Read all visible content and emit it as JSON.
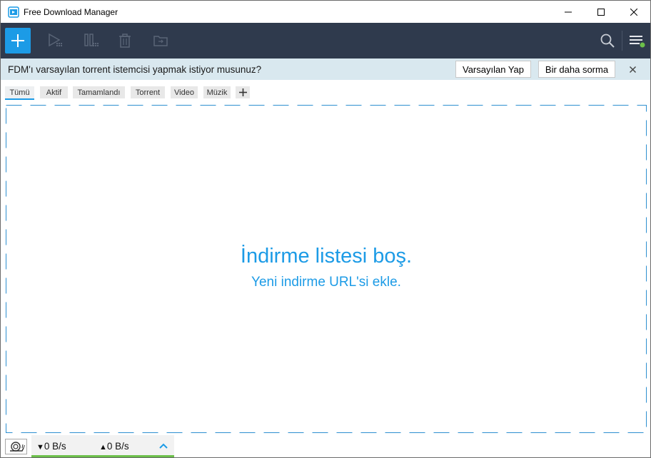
{
  "window": {
    "title": "Free Download Manager"
  },
  "notification": {
    "message": "FDM'ı varsayılan torrent istemcisi yapmak istiyor musunuz?",
    "make_default_label": "Varsayılan Yap",
    "dont_ask_label": "Bir daha sorma"
  },
  "tabs": [
    {
      "label": "Tümü"
    },
    {
      "label": "Aktif"
    },
    {
      "label": "Tamamlandı"
    },
    {
      "label": "Torrent"
    },
    {
      "label": "Video"
    },
    {
      "label": "Müzik"
    }
  ],
  "empty_state": {
    "title": "İndirme listesi boş.",
    "subtitle": "Yeni indirme URL'si ekle."
  },
  "status": {
    "download_speed": "0 B/s",
    "upload_speed": "0 B/s",
    "download_arrow": "▼",
    "upload_arrow": "▲"
  },
  "colors": {
    "accent": "#1c9be6",
    "toolbar_bg": "#2f3a4d",
    "notify_bg": "#d9e8ef",
    "status_ok": "#6cc04a"
  },
  "icons": {
    "app": "fdm-logo-icon",
    "add": "plus-icon",
    "start": "play-icon",
    "pause": "pause-icon",
    "delete": "trash-icon",
    "folder": "folder-icon",
    "search": "search-icon",
    "menu": "hamburger-menu-icon",
    "snail": "snail-icon"
  }
}
